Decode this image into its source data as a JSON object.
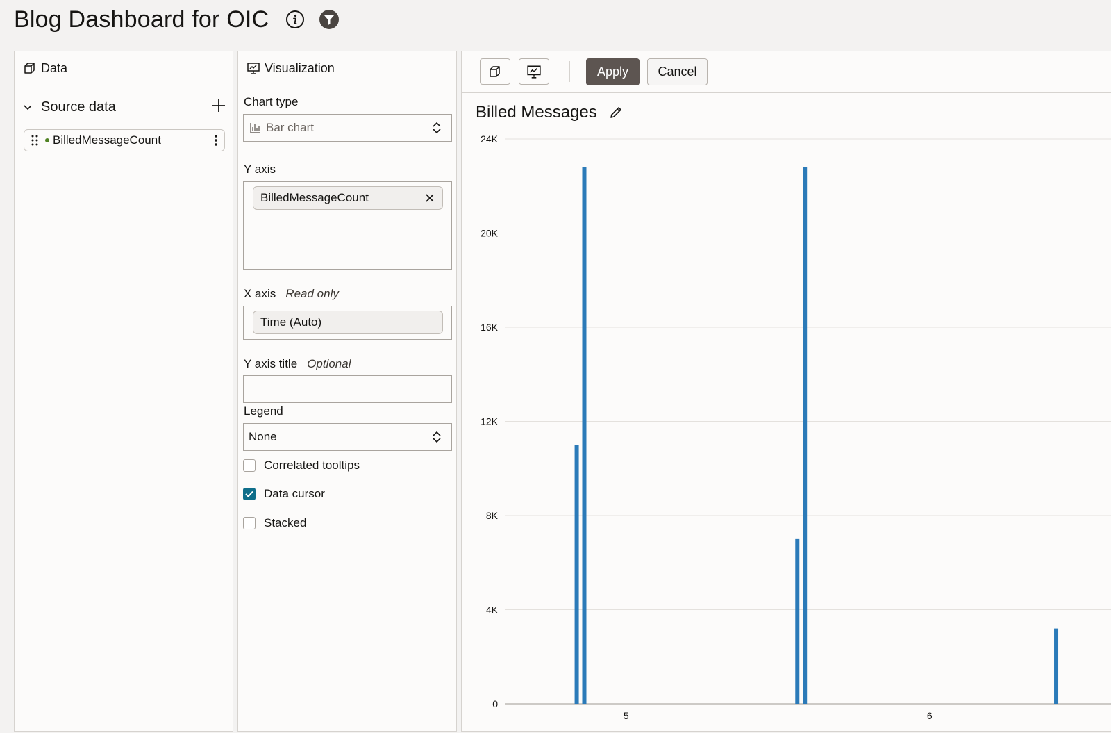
{
  "header": {
    "title": "Blog Dashboard for OIC"
  },
  "data_panel": {
    "heading": "Data",
    "source_label": "Source data",
    "field": "BilledMessageCount"
  },
  "viz_panel": {
    "heading": "Visualization",
    "chart_type_label": "Chart type",
    "chart_type_value": "Bar chart",
    "y_axis_label": "Y axis",
    "y_axis_chip": "BilledMessageCount",
    "x_axis_label": "X axis",
    "x_axis_note": "Read only",
    "x_axis_value": "Time (Auto)",
    "y_title_label": "Y axis title",
    "y_title_note": "Optional",
    "y_title_value": "",
    "legend_label": "Legend",
    "legend_value": "None",
    "options": [
      {
        "label": "Correlated tooltips",
        "checked": false
      },
      {
        "label": "Data cursor",
        "checked": true
      },
      {
        "label": "Stacked",
        "checked": false
      }
    ]
  },
  "toolbar": {
    "apply_label": "Apply",
    "cancel_label": "Cancel"
  },
  "chart_data": {
    "type": "bar",
    "title": "Billed Messages",
    "ylim": [
      0,
      24000
    ],
    "y_ticks": [
      {
        "value": 0,
        "label": "0"
      },
      {
        "value": 4000,
        "label": "4K"
      },
      {
        "value": 8000,
        "label": "8K"
      },
      {
        "value": 12000,
        "label": "12K"
      },
      {
        "value": 16000,
        "label": "16K"
      },
      {
        "value": 20000,
        "label": "20K"
      },
      {
        "value": 24000,
        "label": "24K"
      }
    ],
    "xlim": [
      4.6,
      6.6
    ],
    "x_ticks": [
      {
        "value": 5,
        "label": "5"
      },
      {
        "value": 6,
        "label": "6"
      }
    ],
    "bars": [
      {
        "x": 4.837,
        "y": 11000
      },
      {
        "x": 4.862,
        "y": 22800
      },
      {
        "x": 5.564,
        "y": 7000
      },
      {
        "x": 5.589,
        "y": 22800
      },
      {
        "x": 6.417,
        "y": 3200
      }
    ],
    "bar_color": "#2b7ab8",
    "grid": true
  }
}
